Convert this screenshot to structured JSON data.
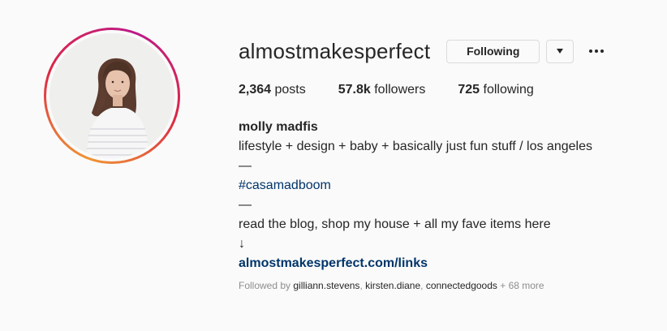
{
  "profile": {
    "username": "almostmakesperfect",
    "avatar_icon": "profile-photo-woman",
    "ring_colors": [
      "#f09433",
      "#dc2743",
      "#bc1888"
    ]
  },
  "actions": {
    "following_label": "Following",
    "dropdown_icon": "caret-down-icon",
    "more_icon": "more-options-icon"
  },
  "stats": {
    "posts_count": "2,364",
    "posts_label": " posts",
    "followers_count": "57.8k",
    "followers_label": " followers",
    "following_count": "725",
    "following_label": " following"
  },
  "bio": {
    "full_name": "molly madfis",
    "line1": "lifestyle + design + baby + basically just fun stuff / los angeles",
    "dash1": "—",
    "hashtag": "#casamadboom",
    "dash2": "—",
    "line2": "read the blog, shop my house + all my fave items here",
    "arrow": "↓",
    "link": "almostmakesperfect.com/links"
  },
  "followed_by": {
    "prefix": "Followed by ",
    "names": [
      "gilliann.stevens",
      "kirsten.diane",
      "connectedgoods"
    ],
    "separator": ", ",
    "more": " + 68 more"
  }
}
